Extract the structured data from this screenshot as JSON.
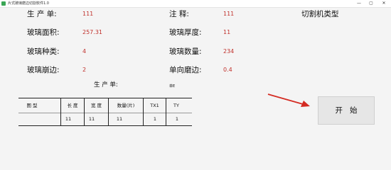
{
  "window": {
    "title": "片式玻璃磨边切割软件1.0",
    "controls": {
      "minimize": "—",
      "maximize": "▢",
      "close": "✕"
    }
  },
  "form": {
    "order_no_label": "生 产 单:",
    "order_no_value": "111",
    "note_label": "注    释:",
    "note_value": "111",
    "area_label": "玻璃面积:",
    "area_value": "257.31",
    "thickness_label": "玻璃厚度:",
    "thickness_value": "11",
    "type_label": "玻璃种类:",
    "type_value": "4",
    "count_label": "玻璃数量:",
    "count_value": "234",
    "edge_label": "玻璃崩边:",
    "edge_value": "2",
    "single_grind_label": "单向磨边:",
    "single_grind_value": "0.4"
  },
  "machine_type_title": "切割机类型",
  "sub": {
    "label": "生 产 单:",
    "value": "单E"
  },
  "table": {
    "headers": [
      "图 型",
      "长 度",
      "宽 度",
      "数量(片)",
      "TX1",
      "TY"
    ],
    "rows": [
      [
        "",
        "11",
        "11",
        "11",
        "1",
        "1"
      ]
    ]
  },
  "start_button": {
    "label": "开始"
  },
  "colors": {
    "value": "#c0302b",
    "arrow": "#d42b22"
  }
}
